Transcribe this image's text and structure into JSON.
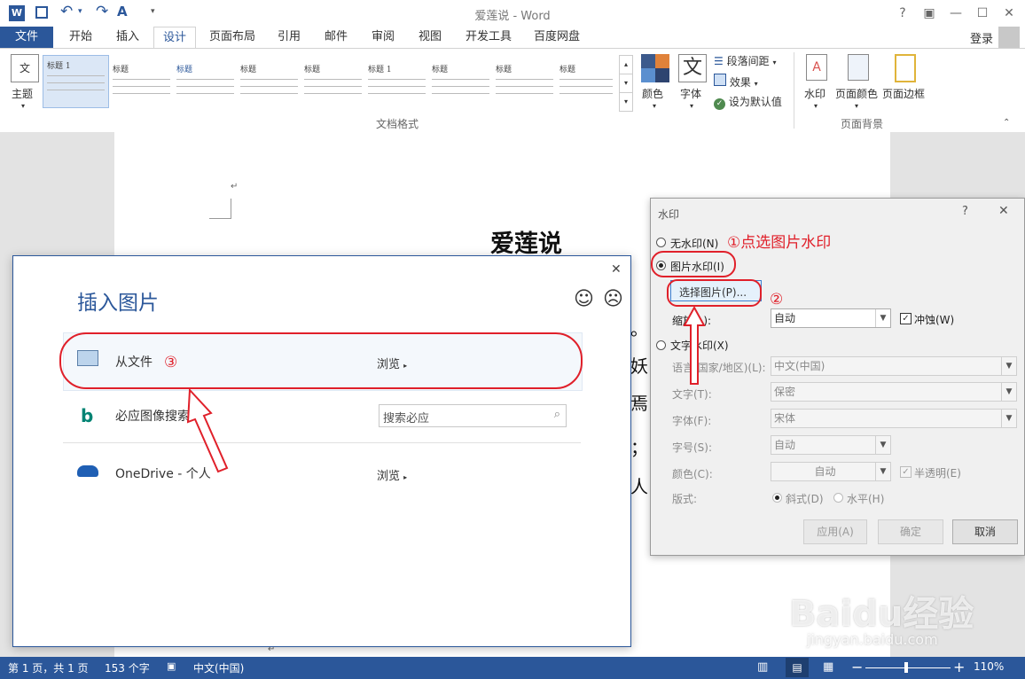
{
  "window": {
    "title": "爱莲说 - Word",
    "help": "?",
    "ribbon_display": "▣",
    "minimize": "—",
    "maximize": "☐",
    "close": "✕"
  },
  "quick_access": {
    "app_icon": "word-logo-icon",
    "save_icon": "save-icon",
    "undo_icon": "undo-icon",
    "redo_icon": "redo-icon",
    "format_icon": "format-painter-icon"
  },
  "tabs": [
    "文件",
    "开始",
    "插入",
    "设计",
    "页面布局",
    "引用",
    "邮件",
    "审阅",
    "视图",
    "开发工具",
    "百度网盘"
  ],
  "active_tab": "设计",
  "login": "登录",
  "ribbon": {
    "theme_label": "主题",
    "document_format_label": "文档格式",
    "style_thumbs": [
      "标题 1",
      "标题",
      "标题",
      "标题",
      "标题",
      "标题 1",
      "标题",
      "标题",
      "标题"
    ],
    "colors_label": "颜色",
    "fonts_label": "字体",
    "fonts_glyph": "文",
    "paragraph_spacing": "段落间距",
    "effects": "效果",
    "set_default": "设为默认值",
    "watermark": "水印",
    "page_color": "页面颜色",
    "page_border": "页面边框",
    "page_background_label": "页面背景"
  },
  "document": {
    "title": "爱莲说",
    "fragments": [
      "。",
      "妖",
      "焉",
      "；",
      "人"
    ],
    "paragraph_mark": "↵"
  },
  "watermark_dialog": {
    "title": "水印",
    "help": "?",
    "close": "✕",
    "no_watermark": "无水印(N)",
    "picture_watermark": "图片水印(I)",
    "select_picture": "选择图片(P)...",
    "scale_label": "缩放(L):",
    "scale_value": "自动",
    "washout_label": "冲蚀(W)",
    "washout_checked": true,
    "text_watermark": "文字水印(X)",
    "language_label": "语言(国家/地区)(L):",
    "language_value": "中文(中国)",
    "text_label": "文字(T):",
    "text_value": "保密",
    "font_label": "字体(F):",
    "font_value": "宋体",
    "size_label": "字号(S):",
    "size_value": "自动",
    "color_label": "颜色(C):",
    "color_value": "自动",
    "semitransparent_label": "半透明(E)",
    "layout_label": "版式:",
    "diagonal": "斜式(D)",
    "horizontal": "水平(H)",
    "apply": "应用(A)",
    "ok": "确定",
    "cancel": "取消"
  },
  "annotations": {
    "step1": "①点选图片水印",
    "step2": "②",
    "step3": "③",
    "color": "#e0202a"
  },
  "insert_picture": {
    "title": "插入图片",
    "close": "✕",
    "smile_icon": "☺",
    "frown_icon": "☹",
    "from_file": "从文件",
    "from_file_browse": "浏览",
    "bing_search": "必应图像搜索",
    "bing_placeholder": "搜索必应",
    "onedrive": "OneDrive - 个人",
    "onedrive_browse": "浏览"
  },
  "status": {
    "page": "第 1 页，共 1 页",
    "words": "153 个字",
    "language": "中文(中国)",
    "zoom": "110%",
    "zoom_minus": "−",
    "zoom_plus": "+"
  },
  "watermark_brand": {
    "text": "Baidu经验",
    "url": "jingyan.baidu.com"
  }
}
